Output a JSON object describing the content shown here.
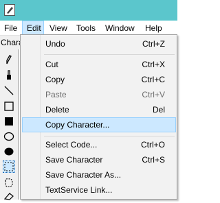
{
  "menubar": {
    "items": [
      {
        "label": "File"
      },
      {
        "label": "Edit"
      },
      {
        "label": "View"
      },
      {
        "label": "Tools"
      },
      {
        "label": "Window"
      },
      {
        "label": "Help"
      }
    ],
    "open_menu": "Edit"
  },
  "toolbar_strip": {
    "text": "Chara"
  },
  "toolbox": {
    "tools": [
      {
        "icon": "pencil-icon"
      },
      {
        "icon": "brush-icon"
      },
      {
        "icon": "line-icon"
      },
      {
        "icon": "rectangle-outline-icon"
      },
      {
        "icon": "rectangle-filled-icon"
      },
      {
        "icon": "ellipse-outline-icon"
      },
      {
        "icon": "ellipse-filled-icon"
      },
      {
        "icon": "rectangle-select-icon",
        "selected": true
      },
      {
        "icon": "freeform-select-icon"
      },
      {
        "icon": "eraser-icon"
      }
    ]
  },
  "edit_menu": {
    "items": [
      {
        "label": "Undo",
        "shortcut": "Ctrl+Z"
      },
      {
        "label": "Cut",
        "shortcut": "Ctrl+X"
      },
      {
        "label": "Copy",
        "shortcut": "Ctrl+C"
      },
      {
        "label": "Paste",
        "shortcut": "Ctrl+V",
        "disabled": true
      },
      {
        "label": "Delete",
        "shortcut": "Del"
      },
      {
        "label": "Copy Character...",
        "shortcut": "",
        "highlighted": true
      },
      {
        "label": "Select Code...",
        "shortcut": "Ctrl+O"
      },
      {
        "label": "Save Character",
        "shortcut": "Ctrl+S"
      },
      {
        "label": "Save Character As...",
        "shortcut": ""
      },
      {
        "label": "TextService Link...",
        "shortcut": ""
      }
    ]
  },
  "colors": {
    "titlebar": "#5bc6cc",
    "highlight": "#cce8ff",
    "highlight_border": "#99d1ff",
    "menu_bg": "#f2f2f2",
    "disabled_text": "#6d6d6d"
  }
}
